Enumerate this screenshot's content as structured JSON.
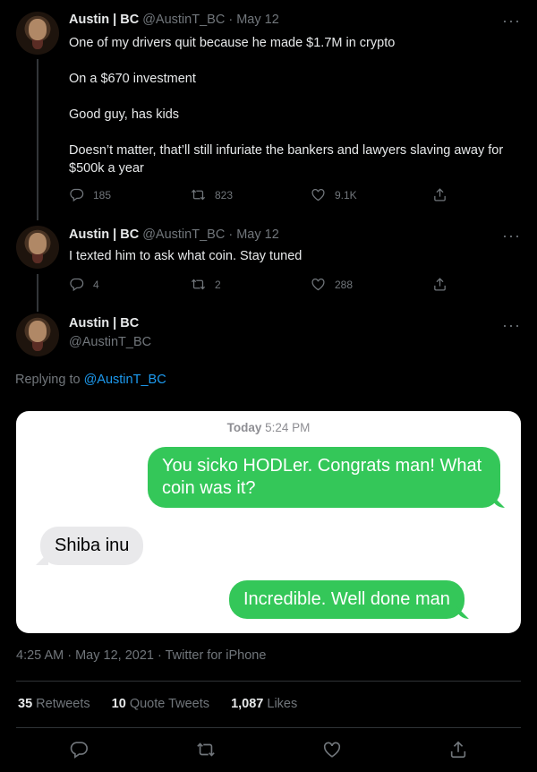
{
  "tweets": [
    {
      "name": "Austin | BC",
      "handle": "@AustinT_BC",
      "separator": "·",
      "date": "May 12",
      "more": "···",
      "paragraphs": [
        "One of my drivers quit because he made $1.7M in crypto",
        "On a $670 investment",
        "Good guy, has kids",
        "Doesn’t matter, that’ll still infuriate the bankers and lawyers slaving away for $500k a year"
      ],
      "replies": "185",
      "retweets": "823",
      "likes": "9.1K"
    },
    {
      "name": "Austin | BC",
      "handle": "@AustinT_BC",
      "separator": "·",
      "date": "May 12",
      "more": "···",
      "paragraphs": [
        "I texted him to ask what coin. Stay tuned"
      ],
      "replies": "4",
      "retweets": "2",
      "likes": "288"
    }
  ],
  "main_tweet": {
    "name": "Austin | BC",
    "handle": "@AustinT_BC",
    "more": "···",
    "replying_prefix": "Replying to",
    "replying_to": "@AustinT_BC",
    "imessage": {
      "time_day": "Today",
      "time_clock": "5:24 PM",
      "messages": [
        {
          "side": "out",
          "text": "You sicko HODLer. Congrats man! What coin was it?"
        },
        {
          "side": "in",
          "text": "Shiba inu"
        },
        {
          "side": "out",
          "text": "Incredible. Well done man"
        }
      ]
    },
    "meta": "4:25 AM · May 12, 2021 · Twitter for iPhone",
    "stats": {
      "retweets_count": "35",
      "retweets_label": "Retweets",
      "quotes_count": "10",
      "quotes_label": "Quote Tweets",
      "likes_count": "1,087",
      "likes_label": "Likes"
    }
  },
  "icons": {
    "reply": "reply-icon",
    "retweet": "retweet-icon",
    "like": "heart-icon",
    "share": "share-icon"
  },
  "colors": {
    "background": "#000000",
    "accent": "#1d9bf0",
    "imessage_green": "#34c759",
    "imessage_gray": "#e9e9eb"
  }
}
